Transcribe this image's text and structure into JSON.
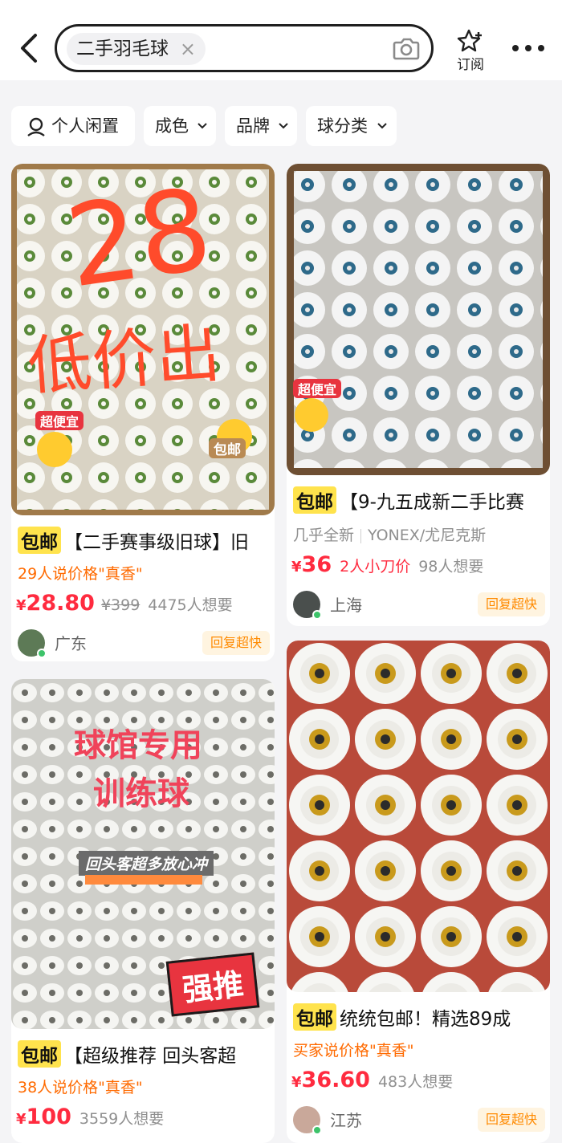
{
  "search": {
    "query": "二手羽毛球",
    "clear_icon": "×"
  },
  "header": {
    "subscribe_label": "订阅"
  },
  "filters": [
    {
      "label": "个人闲置",
      "icon": "person-icon"
    },
    {
      "label": "成色"
    },
    {
      "label": "品牌"
    },
    {
      "label": "球分类"
    }
  ],
  "listings": [
    {
      "image_text": {
        "big": "28",
        "line2": "低价出",
        "tag_left": "超便宜",
        "tag_right": "包邮"
      },
      "badge": "包邮",
      "title": "【二手赛事级旧球】旧",
      "note": "29人说价格\"真香\"",
      "currency": "¥",
      "price": "28.80",
      "original_price": "¥399",
      "wants": "4475人想要",
      "city": "广东",
      "reply": "回复超快"
    },
    {
      "image_text": {
        "tag_left": "超便宜"
      },
      "badge": "包邮",
      "title": "【9-九五成新二手比赛",
      "tags": [
        "几乎全新",
        "YONEX/尤尼克斯"
      ],
      "currency": "¥",
      "price": "36",
      "haggle": "2人小刀价",
      "wants": "98人想要",
      "city": "上海",
      "reply": "回复超快"
    },
    {
      "image_text": {
        "line1": "球馆专用",
        "line2": "训练球",
        "banner": "回头客超多放心冲",
        "stamp": "强推"
      },
      "badge": "包邮",
      "title": "【超级推荐 回头客超",
      "note": "38人说价格\"真香\"",
      "currency": "¥",
      "price": "100",
      "wants": "3559人想要"
    },
    {
      "badge": "包邮",
      "title": "统统包邮！精选89成",
      "note": "买家说价格\"真香\"",
      "currency": "¥",
      "price": "36.60",
      "wants": "483人想要",
      "city": "江苏",
      "reply": "回复超快"
    }
  ],
  "colors": {
    "price_red": "#ff2b3f",
    "note_orange": "#ff6a00",
    "badge_yellow": "#ffe34d"
  }
}
